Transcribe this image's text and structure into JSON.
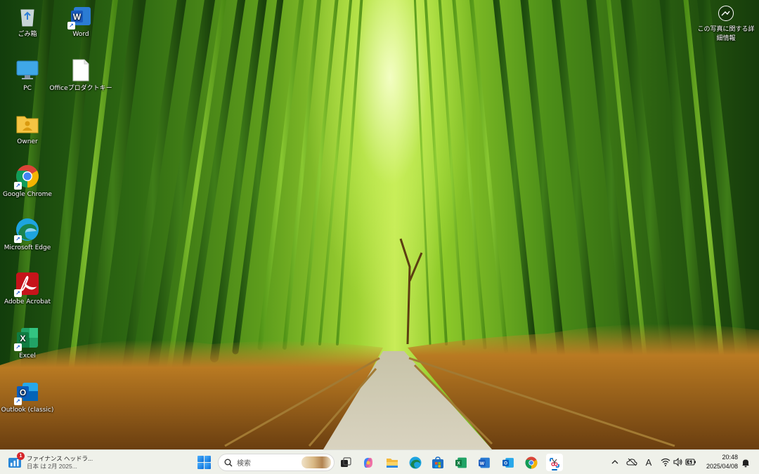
{
  "desktop": {
    "icons": [
      {
        "label": "ごみ箱",
        "icon": "recycle-bin-icon"
      },
      {
        "label": "Word",
        "icon": "word-icon"
      },
      {
        "label": "PC",
        "icon": "monitor-icon"
      },
      {
        "label": "Officeプロダクトキー",
        "icon": "document-icon"
      },
      {
        "label": "Owner",
        "icon": "user-folder-icon"
      },
      {
        "label": "Google Chrome",
        "icon": "chrome-icon"
      },
      {
        "label": "Microsoft Edge",
        "icon": "edge-icon"
      },
      {
        "label": "Adobe Acrobat",
        "icon": "acrobat-icon"
      },
      {
        "label": "Excel",
        "icon": "excel-icon"
      },
      {
        "label": "Outlook (classic)",
        "icon": "outlook-icon"
      }
    ]
  },
  "photo_info": {
    "line1": "この写真に関する詳",
    "line2": "細情報",
    "icon": "camera-info-icon"
  },
  "taskbar": {
    "news": {
      "title": "ファイナンス ヘッドラ...",
      "subtitle": "日本 は 2月 2025...",
      "badge": "1"
    },
    "search": {
      "placeholder": "検索"
    },
    "apps": [
      {
        "name": "task-view",
        "icon": "task-view-icon"
      },
      {
        "name": "copilot",
        "icon": "copilot-icon"
      },
      {
        "name": "file-explorer",
        "icon": "folder-icon"
      },
      {
        "name": "edge",
        "icon": "edge-icon"
      },
      {
        "name": "store",
        "icon": "store-icon"
      },
      {
        "name": "excel",
        "icon": "excel-icon"
      },
      {
        "name": "word",
        "icon": "word-icon"
      },
      {
        "name": "outlook",
        "icon": "outlook-icon"
      },
      {
        "name": "chrome",
        "icon": "chrome-icon"
      },
      {
        "name": "snipping-tool",
        "icon": "snipping-tool-icon"
      }
    ],
    "tray": {
      "ime": "A"
    },
    "clock": {
      "time": "20:48",
      "date": "2025/04/08"
    }
  },
  "colors": {
    "taskbar_bg": "#eff1ea",
    "accent": "#0067c0"
  }
}
